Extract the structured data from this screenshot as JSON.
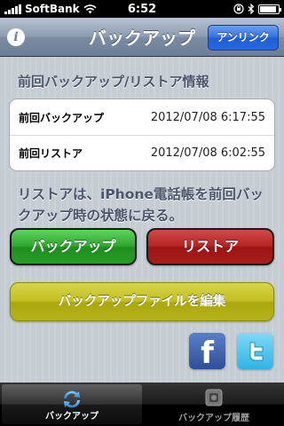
{
  "status_bar": {
    "carrier": "SoftBank",
    "time": "6:52"
  },
  "nav": {
    "title": "バックアップ",
    "unlink_label": "アンリンク",
    "info_glyph": "i"
  },
  "section": {
    "header": "前回バックアップ/リストア情報",
    "rows": [
      {
        "label": "前回バックアップ",
        "value": "2012/07/08 6:17:55"
      },
      {
        "label": "前回リストア",
        "value": "2012/07/08 6:02:55"
      }
    ]
  },
  "description": "リストアは、iPhone電話帳を前回バックアップ時の状態に戻る。",
  "buttons": {
    "backup": "バックアップ",
    "restore": "リストア",
    "edit": "バックアップファイルを編集"
  },
  "social": {
    "facebook_glyph": "f",
    "icons": [
      "facebook-icon",
      "twitter-icon"
    ]
  },
  "tabs": [
    {
      "label": "バックアップ",
      "icon": "sync-icon",
      "active": true
    },
    {
      "label": "バックアップ履歴",
      "icon": "history-icon",
      "active": false
    }
  ],
  "colors": {
    "nav_bar": "#7a8ba2",
    "unlink_button": "#2f6fe0",
    "backup_button": "#2fa62f",
    "restore_button": "#b52424",
    "edit_button": "#c2be22",
    "header_text": "#4c566c"
  }
}
